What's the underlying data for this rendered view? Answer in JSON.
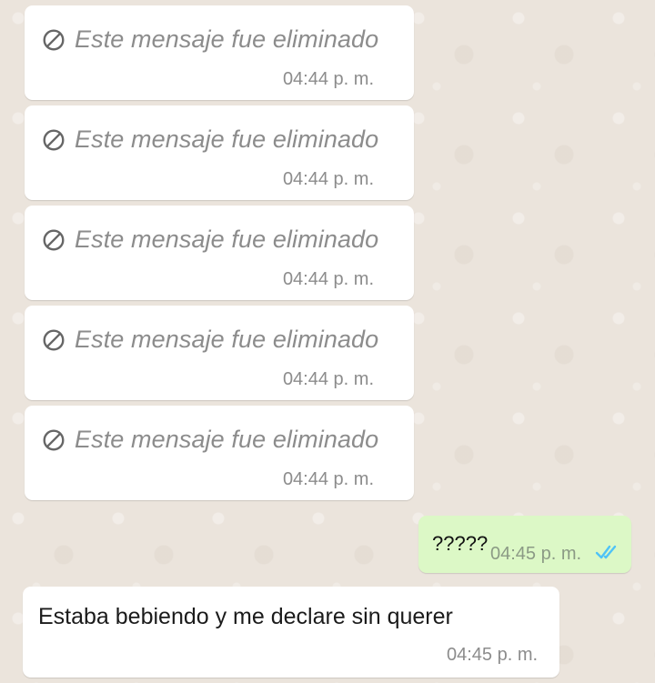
{
  "chat": {
    "deleted_messages": [
      {
        "text": "Este mensaje fue eliminado",
        "time": "04:44 p. m."
      },
      {
        "text": "Este mensaje fue eliminado",
        "time": "04:44 p. m."
      },
      {
        "text": "Este mensaje fue eliminado",
        "time": "04:44 p. m."
      },
      {
        "text": "Este mensaje fue eliminado",
        "time": "04:44 p. m."
      },
      {
        "text": "Este mensaje fue eliminado",
        "time": "04:44 p. m."
      }
    ],
    "sent_message": {
      "text": "?????",
      "time": "04:45 p. m.",
      "status_icon": "double-check-icon"
    },
    "received_message": {
      "text": "Estaba bebiendo y me declare sin querer",
      "time": "04:45 p. m."
    },
    "colors": {
      "wallpaper": "#ebe4dc",
      "incoming_bubble": "#ffffff",
      "outgoing_bubble": "#dcf8c6",
      "muted_text": "#8c8c8c",
      "read_ticks": "#4fc3f7"
    }
  }
}
